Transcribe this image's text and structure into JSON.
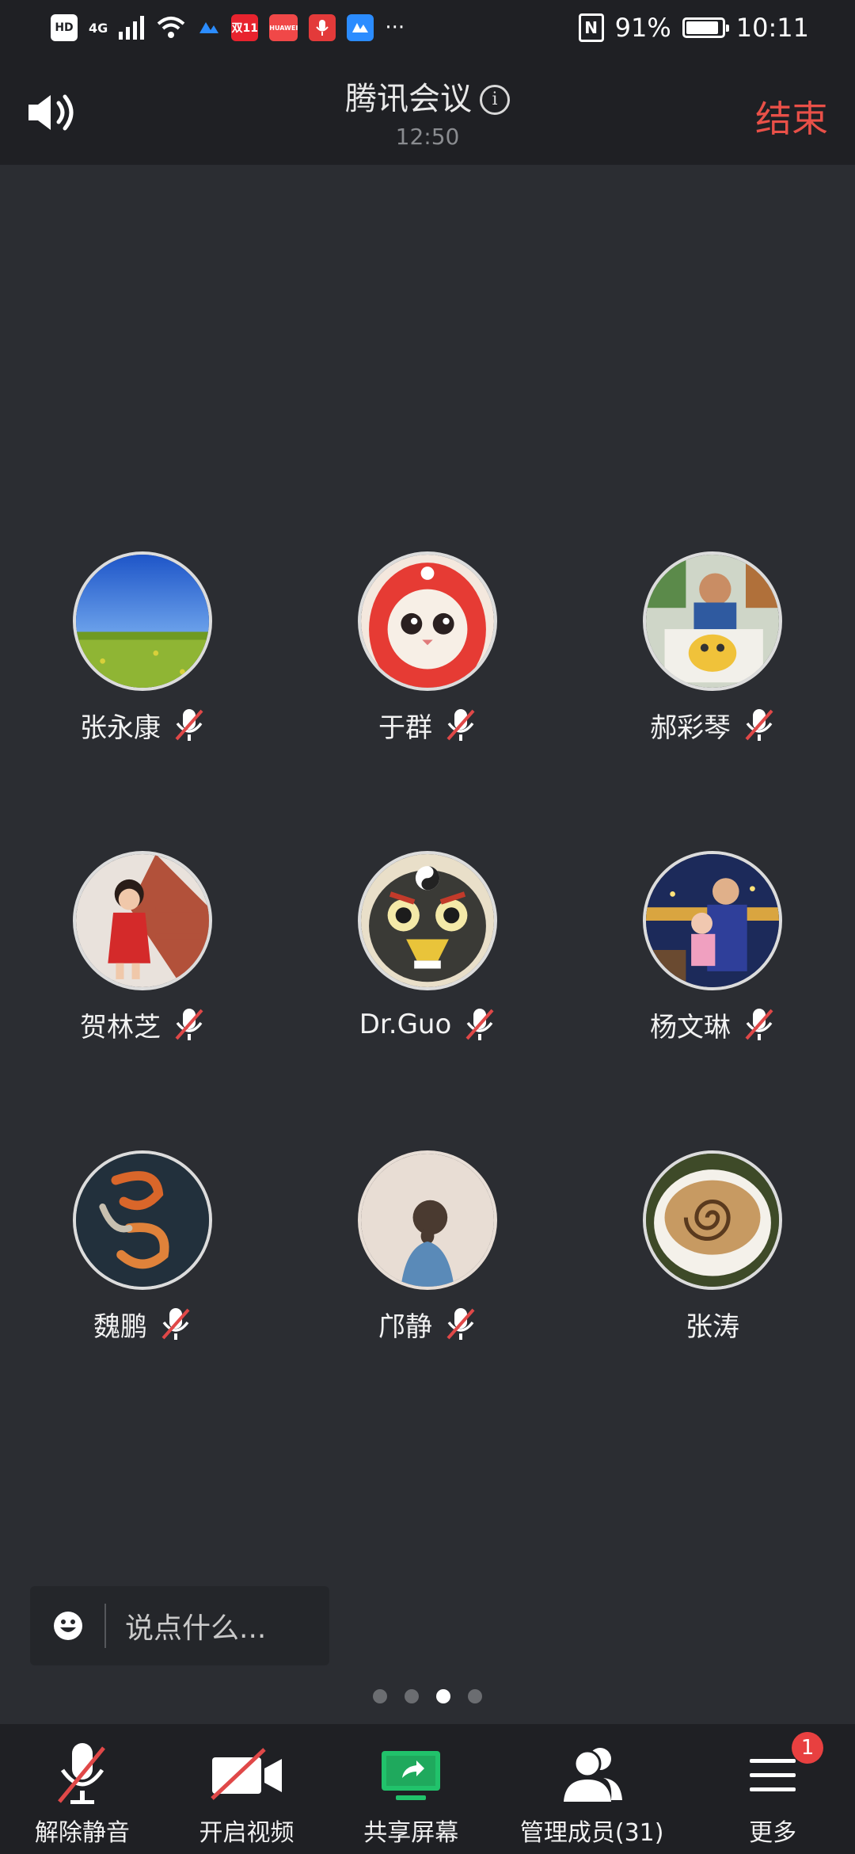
{
  "status_bar": {
    "hd": "HD",
    "network": "4G",
    "chip_labels": [
      "双11",
      "HUAWEI"
    ],
    "more": "···",
    "nfc": "N",
    "battery_text": "91%",
    "battery_level": 0.91,
    "time": "10:11"
  },
  "header": {
    "title": "腾讯会议",
    "info": "i",
    "timer": "12:50",
    "end_label": "结束"
  },
  "participants": [
    {
      "name": "张永康",
      "muted": true,
      "avatar": "landscape-field"
    },
    {
      "name": "于群",
      "muted": true,
      "avatar": "cat-red-hood"
    },
    {
      "name": "郝彩琴",
      "muted": true,
      "avatar": "boy-drawing"
    },
    {
      "name": "贺林芝",
      "muted": true,
      "avatar": "girl-red-dress"
    },
    {
      "name": "Dr.Guo",
      "muted": true,
      "avatar": "lion-mask"
    },
    {
      "name": "杨文琳",
      "muted": true,
      "avatar": "father-baby"
    },
    {
      "name": "魏鹏",
      "muted": true,
      "avatar": "koi-fish"
    },
    {
      "name": "邝静",
      "muted": true,
      "avatar": "girl-back"
    },
    {
      "name": "张涛",
      "muted": false,
      "avatar": "coffee-cup"
    }
  ],
  "chat": {
    "placeholder": "说点什么..."
  },
  "pager": {
    "count": 4,
    "active_index": 2
  },
  "toolbar": {
    "unmute": "解除静音",
    "video": "开启视频",
    "share": "共享屏幕",
    "members": "管理成员(31)",
    "more": "更多",
    "more_badge": "1"
  },
  "colors": {
    "end": "#e95048",
    "share_green": "#21c26b",
    "badge": "#e84040"
  }
}
